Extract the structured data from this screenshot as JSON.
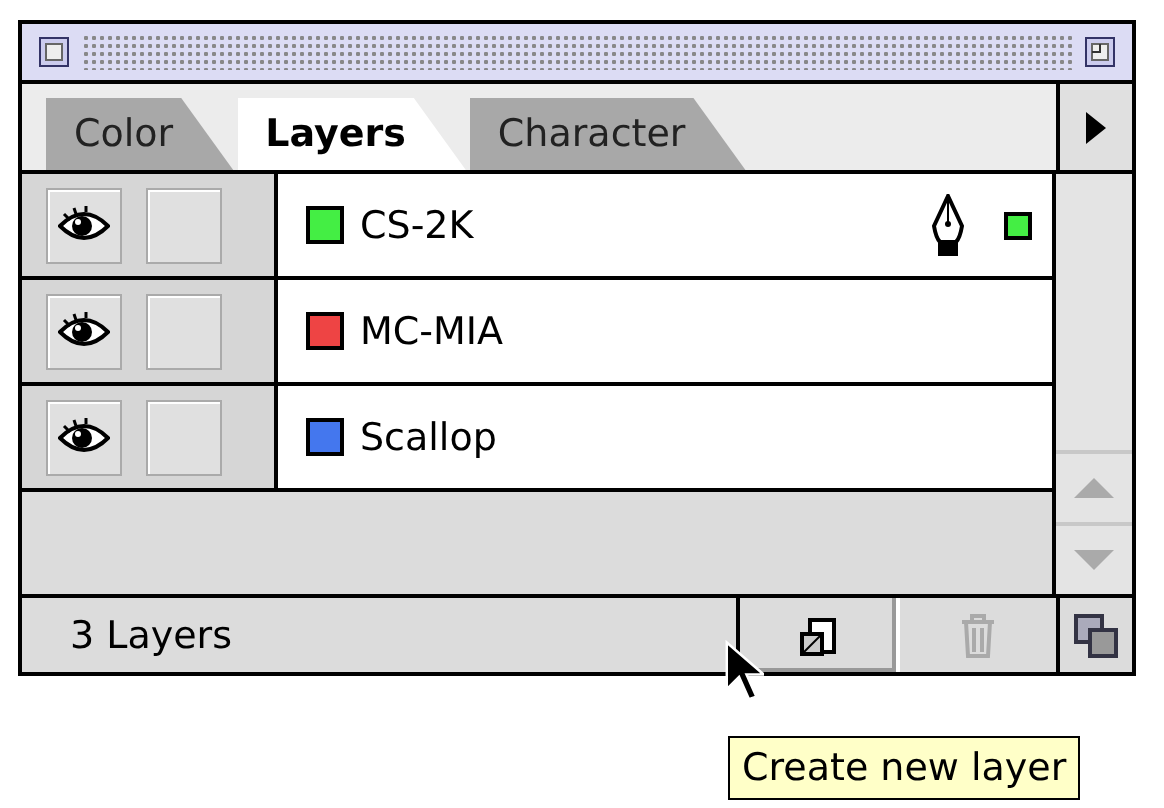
{
  "tabs": [
    {
      "label": "Color",
      "selected": false
    },
    {
      "label": "Layers",
      "selected": true
    },
    {
      "label": "Character",
      "selected": false
    }
  ],
  "layers": [
    {
      "name": "CS-2K",
      "color": "#44ee44",
      "visible": true,
      "locked": false,
      "current": true
    },
    {
      "name": "MC-MIA",
      "color": "#ee4444",
      "visible": true,
      "locked": false,
      "current": false
    },
    {
      "name": "Scallop",
      "color": "#4477ee",
      "visible": true,
      "locked": false,
      "current": false
    }
  ],
  "status": "3 Layers",
  "delete_disabled": true,
  "tooltip": "Create new layer"
}
